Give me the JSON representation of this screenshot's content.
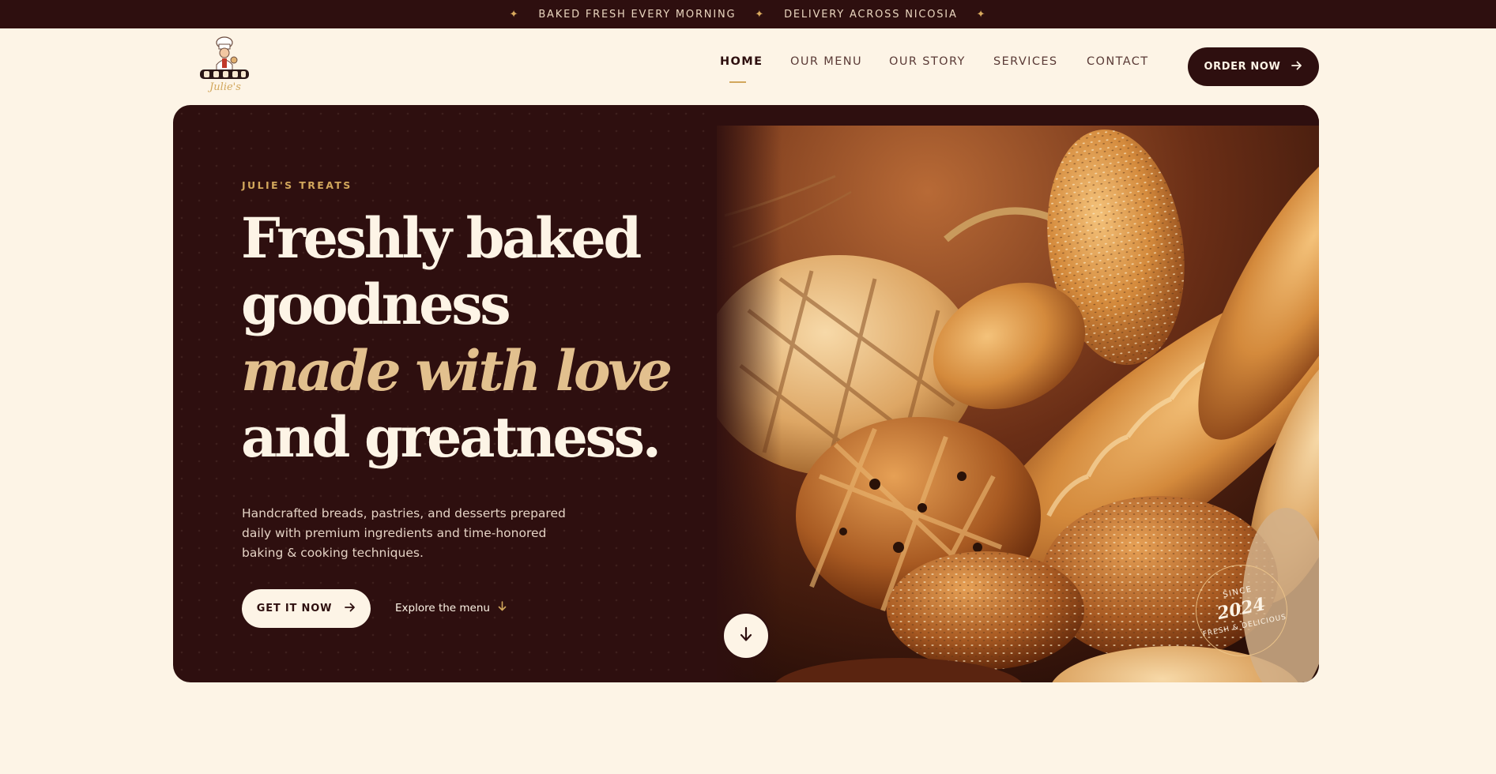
{
  "announcement": {
    "items": [
      "BAKED FRESH EVERY MORNING",
      "DELIVERY ACROSS NICOSIA"
    ],
    "separator_icon": "sparkle-star-icon",
    "accent_color": "#d9aa5e"
  },
  "brand": {
    "logo_icon": "chef-mascot-logo",
    "logo_text": "Julie's"
  },
  "nav": {
    "items": [
      {
        "label": "HOME",
        "active": true
      },
      {
        "label": "OUR MENU",
        "active": false
      },
      {
        "label": "OUR STORY",
        "active": false
      },
      {
        "label": "SERVICES",
        "active": false
      },
      {
        "label": "CONTACT",
        "active": false
      }
    ],
    "order_button": "ORDER NOW",
    "order_icon": "arrow-right-icon"
  },
  "hero": {
    "eyebrow": "JULIE'S TREATS",
    "headline": {
      "line1": "Freshly baked",
      "line2": "goodness",
      "line3": "made with love",
      "line4": "and greatness."
    },
    "description": "Handcrafted breads, pastries, and desserts prepared daily with premium ingredients and time-honored baking & cooking techniques.",
    "primary_button": "GET IT NOW",
    "secondary_link": "Explore the menu",
    "scroll_icon": "arrow-down-icon",
    "image": "assorted-fresh-bread-photo",
    "badge": {
      "since": "SINCE",
      "year": "2024",
      "tagline": "FRESH & DELICIOUS"
    }
  },
  "colors": {
    "maroon": "#2e0f0f",
    "cream": "#fdf4e6",
    "gold": "#d2a75c",
    "accent_text": "#e2c08e"
  }
}
